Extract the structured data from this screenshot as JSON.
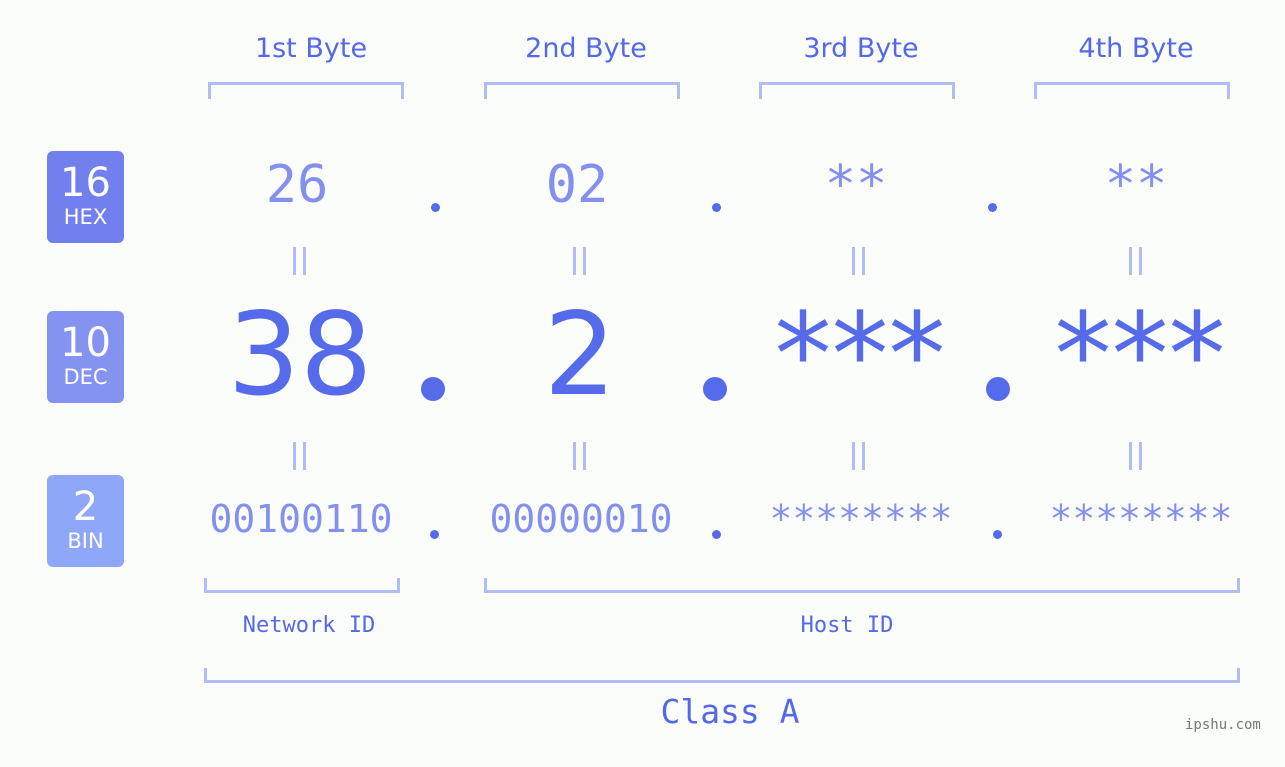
{
  "colors": {
    "primary": "#556bea",
    "light_text": "#8390ee",
    "bracket": "#b3bdf5",
    "badge_hex": "#7180ec",
    "badge_dec": "#8493f0",
    "badge_bin": "#8fa7f8",
    "background": "#fbfdfb"
  },
  "headers": [
    "1st Byte",
    "2nd Byte",
    "3rd Byte",
    "4th Byte"
  ],
  "badges": {
    "hex": {
      "num": "16",
      "label": "HEX"
    },
    "dec": {
      "num": "10",
      "label": "DEC"
    },
    "bin": {
      "num": "2",
      "label": "BIN"
    }
  },
  "hex": [
    "26",
    "02",
    "**",
    "**"
  ],
  "dec": [
    "38",
    "2",
    "***",
    "***"
  ],
  "bin": [
    "00100110",
    "00000010",
    "********",
    "********"
  ],
  "separator": ".",
  "labels": {
    "network_id": "Network ID",
    "host_id": "Host ID",
    "class": "Class A"
  },
  "watermark": "ipshu.com"
}
